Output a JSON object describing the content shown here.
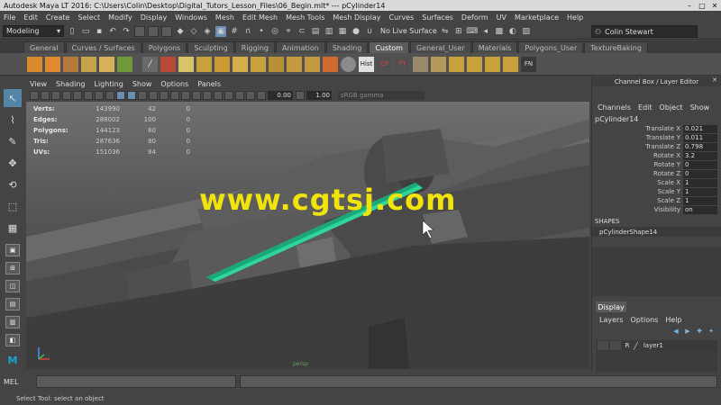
{
  "window": {
    "title": "Autodesk Maya LT 2016: C:\\Users\\Colin\\Desktop\\Digital_Tutors_Lesson_Files\\06_Begin.mlt*  ---  pCylinder14",
    "minimize": "–",
    "maximize": "□",
    "close": "✕"
  },
  "menubar": [
    "File",
    "Edit",
    "Create",
    "Select",
    "Modify",
    "Display",
    "Windows",
    "Mesh",
    "Edit Mesh",
    "Mesh Tools",
    "Mesh Display",
    "Curves",
    "Surfaces",
    "Deform",
    "UV",
    "Marketplace",
    "Help"
  ],
  "statusline": {
    "mode": "Modeling",
    "live_surface": "No Live Surface",
    "user": "Colin Stewart"
  },
  "shelf": {
    "tabs": [
      "General",
      "Curves / Surfaces",
      "Polygons",
      "Sculpting",
      "Rigging",
      "Animation",
      "Shading",
      "Custom",
      "General_User",
      "Materials",
      "Polygons_User",
      "TextureBaking"
    ],
    "active_tab": "Custom",
    "icon_labels": {
      "hist": "Hist",
      "cp": "CP",
      "ft": "FT",
      "fn": "FN"
    }
  },
  "viewport": {
    "menu": [
      "View",
      "Shading",
      "Lighting",
      "Show",
      "Options",
      "Panels"
    ],
    "exposure": "0.00",
    "gamma": "1.00",
    "color_space": "sRGB gamma",
    "hud": [
      {
        "label": "Verts:",
        "v1": "143990",
        "v2": "42",
        "v3": "0"
      },
      {
        "label": "Edges:",
        "v1": "288002",
        "v2": "100",
        "v3": "0"
      },
      {
        "label": "Polygons:",
        "v1": "144123",
        "v2": "60",
        "v3": "0"
      },
      {
        "label": "Tris:",
        "v1": "287636",
        "v2": "80",
        "v3": "0"
      },
      {
        "label": "UVs:",
        "v1": "151036",
        "v2": "84",
        "v3": "0"
      }
    ],
    "watermark": "www.cgtsj.com",
    "camera_label": "persp"
  },
  "mel": {
    "label": "MEL"
  },
  "helpline": "Select Tool: select an object",
  "channelbox": {
    "title": "Channel Box / Layer Editor",
    "menu": [
      "Channels",
      "Edit",
      "Object",
      "Show"
    ],
    "node": "pCylinder14",
    "attributes": [
      {
        "name": "Translate X",
        "value": "0.021"
      },
      {
        "name": "Translate Y",
        "value": "0.011"
      },
      {
        "name": "Translate Z",
        "value": "0.798"
      },
      {
        "name": "Rotate X",
        "value": "3.2"
      },
      {
        "name": "Rotate Y",
        "value": "0"
      },
      {
        "name": "Rotate Z",
        "value": "0"
      },
      {
        "name": "Scale X",
        "value": "1"
      },
      {
        "name": "Scale Y",
        "value": "1"
      },
      {
        "name": "Scale Z",
        "value": "1"
      },
      {
        "name": "Visibility",
        "value": "on"
      }
    ],
    "shapes_header": "SHAPES",
    "shape_node": "pCylinderShape14"
  },
  "layers": {
    "display_tab": "Display",
    "menu": [
      "Layers",
      "Options",
      "Help"
    ],
    "row": {
      "ref": "R",
      "name": "layer1"
    }
  },
  "colors": {
    "accent": "#5285a6",
    "selection_green": "#2fd69a",
    "watermark": "#f0e40a"
  }
}
